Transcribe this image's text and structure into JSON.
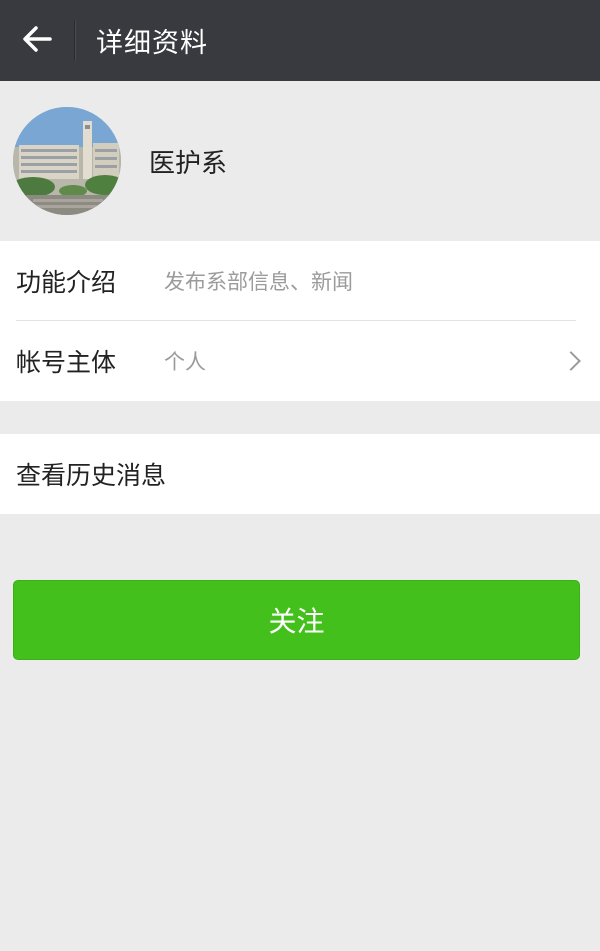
{
  "header": {
    "title": "详细资料",
    "back_icon": "arrow-left-icon",
    "background": "#393a3f"
  },
  "profile": {
    "name": "医护系",
    "avatar": "avatar-image"
  },
  "details": {
    "items": [
      {
        "label": "功能介绍",
        "value": "发布系部信息、新闻"
      },
      {
        "label": "帐号主体",
        "value": "个人",
        "icon": "chevron-right-icon"
      }
    ]
  },
  "history": {
    "label": "查看历史消息"
  },
  "actions": {
    "follow_label": "关注",
    "follow_color": "#44c01c"
  }
}
